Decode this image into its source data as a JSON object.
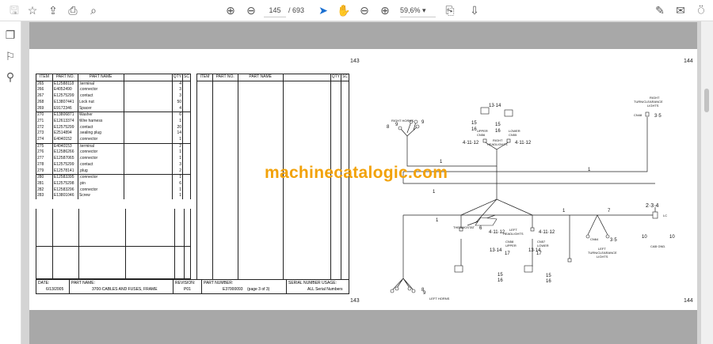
{
  "toolbar": {
    "page_current": "145",
    "page_total": "/ 693",
    "zoom": "59,6%",
    "icons": [
      "save-icon",
      "bookmark-star-icon",
      "upload-icon",
      "print-icon",
      "find-icon",
      "prev-page-icon",
      "next-page-icon",
      "select-cursor-icon",
      "hand-icon",
      "zoom-out-icon",
      "zoom-in-icon",
      "fit-page-icon",
      "scroll-mode-icon",
      "sign-icon",
      "email-icon",
      "account-icon"
    ]
  },
  "sidebar": {
    "icons": [
      "pages-icon",
      "bookmarks-icon",
      "attachments-icon"
    ]
  },
  "left_page": {
    "page_number": "143",
    "headers": [
      "ITEM",
      "PART NO.",
      "PART NAME",
      "QTY",
      "SC"
    ],
    "rows": [
      [
        "265",
        "E12588118",
        ".terminal",
        "4"
      ],
      [
        "266",
        "E4052490",
        ".connector",
        "3"
      ],
      [
        "267",
        "E12575299",
        ".contact",
        "3"
      ],
      [
        "268",
        "E13807441",
        "Lock nut",
        "50"
      ],
      [
        "269",
        "E9172346",
        "Spacer",
        "4"
      ],
      [
        "270",
        "E13806871",
        "Washer",
        "6"
      ],
      [
        "271",
        "E12613374",
        "Wire harness",
        "1"
      ],
      [
        "272",
        "E12575299",
        ".contact",
        "20"
      ],
      [
        "273",
        "E2514894",
        ".sealing plug",
        "14"
      ],
      [
        "274",
        "E4040152",
        ".connector",
        "1"
      ],
      [
        "275",
        "E4040153",
        ".terminal",
        "2"
      ],
      [
        "276",
        "E12586266",
        ".connector",
        "1"
      ],
      [
        "277",
        "E12587065",
        ".connector",
        "1"
      ],
      [
        "278",
        "E12575299",
        ".contact",
        "3"
      ],
      [
        "279",
        "E12578141",
        ".plug",
        "2"
      ],
      [
        "280",
        "E12583395",
        ".connector",
        "1"
      ],
      [
        "281",
        "E12575298",
        ".pin",
        "6"
      ],
      [
        "282",
        "E12583296",
        ".connector",
        "1"
      ],
      [
        "283",
        "E13801046",
        "Screw",
        "1"
      ]
    ],
    "footer": {
      "date_label": "DATE:",
      "date": "6/13/2005",
      "part_name_label": "PART NAME:",
      "part_name": "3700-CABLES AND FUSES, FRAME",
      "revision_label": "REVISION:",
      "revision": "P01",
      "part_number_label": "PART NUMBER:",
      "part_number": "E37000093",
      "page_of": "(page 3 of 3)",
      "serial_label": "SERIAL NUMBER USAGE:",
      "serial": "ALL Serial Numbers"
    }
  },
  "right_page": {
    "page_number": "144",
    "labels": {
      "right_horns": "RIGHT HORNS",
      "n8": "8",
      "n9": "9",
      "n1": "1",
      "n13_14": "13·14",
      "n15": "15",
      "n16": "16",
      "upper": "UPPER",
      "cn56": "CN56",
      "lower": "LOWER",
      "cn55": "CN55",
      "right_headlights_1": "RIGHT",
      "right_headlights_2": "HEADLIGHTS",
      "n4_11_12": "4·11·12",
      "right_turn_1": "RIGHT",
      "right_turn_2": "TURN/CLEARANCE",
      "right_turn_3": "LIGHTS",
      "cn48": "CN48",
      "n3_5": "3·5",
      "n6": "6",
      "thermostat": "THERMOSTAT",
      "n2_3_4": "2·3·4",
      "lc": "LC",
      "n7": "7",
      "left_headlights_1": "LEFT",
      "left_headlights_2": "HEADLIGHTS",
      "cn58": "CN58",
      "cn57": "CN57",
      "lower2": "LOWER",
      "cn64": "CN64",
      "left_turn_1": "LEFT",
      "left_turn_2": "TURN/CLEARANCE",
      "left_turn_3": "LIGHTS",
      "n10": "10",
      "cab_gnd": "CAB GND.",
      "left_horns": "LEFT HORNS",
      "n17": "17"
    }
  },
  "watermark": "machinecatalogic.com"
}
